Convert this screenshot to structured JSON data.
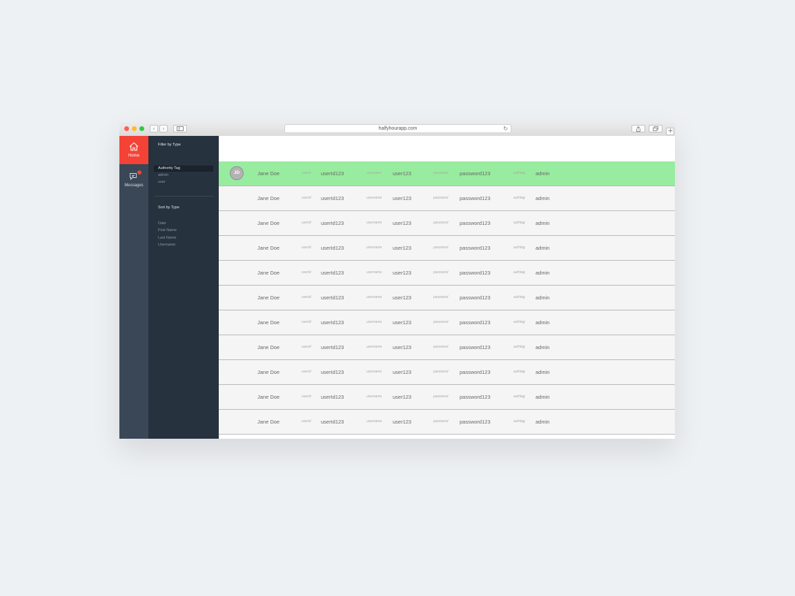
{
  "browser": {
    "url": "halfyhourapp.com",
    "back_glyph": "‹",
    "forward_glyph": "›",
    "reload_glyph": "↻",
    "colors": {
      "close": "#fc5f57",
      "minimize": "#fdbc2e",
      "zoom": "#33c748"
    }
  },
  "nav": {
    "items": [
      {
        "label": "Home",
        "icon": "home-icon",
        "active": true
      },
      {
        "label": "Messages",
        "icon": "chat-icon",
        "has_badge": true
      }
    ],
    "accent": "#f44336"
  },
  "filter": {
    "filter_title": "Filter by Type",
    "authority_tag": "Authority Tag",
    "options": [
      "admin",
      "user"
    ],
    "sort_title": "Sort by Type",
    "sort_options": [
      "Date",
      "First Name",
      "Last Name",
      "Username"
    ]
  },
  "users": {
    "labels": {
      "userid": "userid",
      "username": "username",
      "password": "password",
      "authtag": "authtag"
    },
    "selected_color": "#98ec9f",
    "rows": [
      {
        "initials": "JD",
        "name": "Jane Doe",
        "userid": "userId123",
        "username": "user123",
        "password": "password123",
        "authtag": "admin"
      },
      {
        "initials": "",
        "name": "Jane Doe",
        "userid": "userId123",
        "username": "user123",
        "password": "password123",
        "authtag": "admin"
      },
      {
        "initials": "",
        "name": "Jane Doe",
        "userid": "userId123",
        "username": "user123",
        "password": "password123",
        "authtag": "admin"
      },
      {
        "initials": "",
        "name": "Jane Doe",
        "userid": "userId123",
        "username": "user123",
        "password": "password123",
        "authtag": "admin"
      },
      {
        "initials": "",
        "name": "Jane Doe",
        "userid": "userId123",
        "username": "user123",
        "password": "password123",
        "authtag": "admin"
      },
      {
        "initials": "",
        "name": "Jane Doe",
        "userid": "userId123",
        "username": "user123",
        "password": "password123",
        "authtag": "admin"
      },
      {
        "initials": "",
        "name": "Jane Doe",
        "userid": "userId123",
        "username": "user123",
        "password": "password123",
        "authtag": "admin"
      },
      {
        "initials": "",
        "name": "Jane Doe",
        "userid": "userId123",
        "username": "user123",
        "password": "password123",
        "authtag": "admin"
      },
      {
        "initials": "",
        "name": "Jane Doe",
        "userid": "userId123",
        "username": "user123",
        "password": "password123",
        "authtag": "admin"
      },
      {
        "initials": "",
        "name": "Jane Doe",
        "userid": "userId123",
        "username": "user123",
        "password": "password123",
        "authtag": "admin"
      },
      {
        "initials": "",
        "name": "Jane Doe",
        "userid": "userId123",
        "username": "user123",
        "password": "password123",
        "authtag": "admin"
      }
    ]
  }
}
